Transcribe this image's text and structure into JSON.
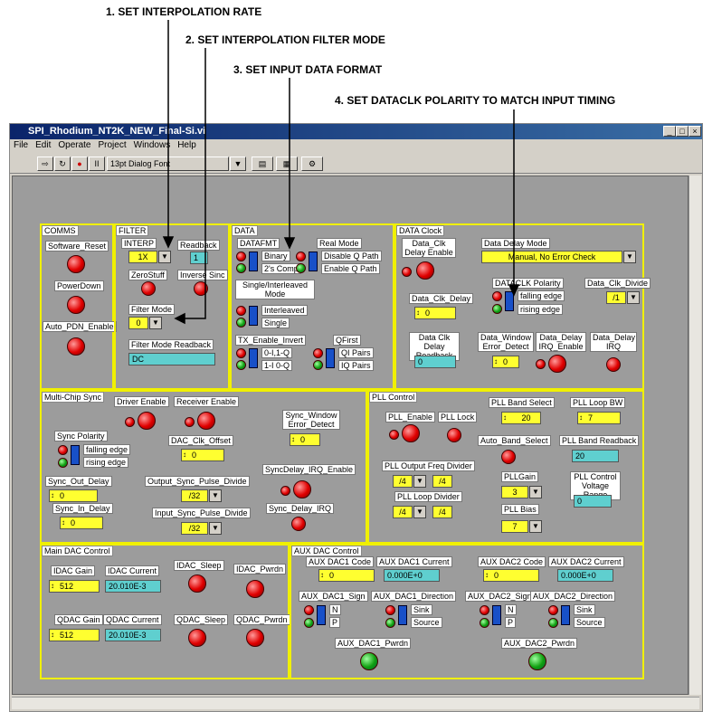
{
  "annotations": {
    "a1": "1. SET INTERPOLATION RATE",
    "a2": "2. SET INTERPOLATION FILTER MODE",
    "a3": "3. SET INPUT DATA FORMAT",
    "a4": "4. SET DATACLK POLARITY TO MATCH INPUT TIMING"
  },
  "window": {
    "title": "SPI_Rhodium_NT2K_NEW_Final-Si.vi",
    "min": "_",
    "max": "□",
    "close": "×"
  },
  "menu": [
    "File",
    "Edit",
    "Operate",
    "Project",
    "Windows",
    "Help"
  ],
  "toolbar": {
    "font": "13pt Dialog Font"
  },
  "comms": {
    "title": "COMMS",
    "software_reset": "Software_Reset",
    "powerdown": "PowerDown",
    "auto_pdn": "Auto_PDN_Enable"
  },
  "filter": {
    "title": "FILTER",
    "interp": "INTERP",
    "interp_val": "1X",
    "readback": "Readback",
    "readback_val": "1",
    "zerostuff": "ZeroStuff",
    "inverse_sinc": "Inverse Sinc",
    "filter_mode": "Filter Mode",
    "filter_mode_val": "0",
    "fm_readback": "Filter Mode Readback",
    "fm_readback_val": "DC"
  },
  "data": {
    "title": "DATA",
    "datafmt": "DATAFMT",
    "binary": "Binary",
    "twos": "2's Comp",
    "real_mode": "Real Mode",
    "disable_q": "Disable Q Path",
    "enable_q": "Enable Q Path",
    "single_inter": "Single/Interleaved Mode",
    "interleaved": "Interleaved",
    "single": "Single",
    "tx_enable": "TX_Enable_Invert",
    "tx0": "0-I,1-Q",
    "tx1": "1-I 0-Q",
    "qfirst": "QFirst",
    "qi": "QI Pairs",
    "iq": "IQ Pairs"
  },
  "dataclk": {
    "title": "DATA Clock",
    "delay_enable": "Data_Clk Delay Enable",
    "delay_mode": "Data Delay Mode",
    "delay_mode_val": "Manual, No Error Check",
    "clk_delay": "Data_Clk_Delay",
    "clk_delay_val": "0",
    "polarity": "DATACLK Polarity",
    "falling": "falling edge",
    "rising": "rising edge",
    "clk_divide": "Data_Clk_Divide",
    "clk_divide_val": "/1",
    "delay_rb": "Data Clk Delay Readback",
    "delay_rb_val": "0",
    "win_err": "Data_Window Error_Detect",
    "win_err_val": "0",
    "irq_en": "Data_Delay IRQ_Enable",
    "irq": "Data_Delay IRQ"
  },
  "mcs": {
    "title": "Multi-Chip Sync",
    "driver": "Driver Enable",
    "receiver": "Receiver Enable",
    "sync_win": "Sync_Window Error_Detect",
    "sync_win_val": "0",
    "sync_pol": "Sync Polarity",
    "falling": "falling edge",
    "rising": "rising edge",
    "dac_clk_off": "DAC_Clk_Offset",
    "dac_clk_off_val": "0",
    "sync_out": "Sync_Out_Delay",
    "sync_out_val": "0",
    "out_pulse": "Output_Sync_Pulse_Divide",
    "out_pulse_val": "/32",
    "irq_en": "SyncDelay_IRQ_Enable",
    "sync_in": "Sync_In_Delay",
    "sync_in_val": "0",
    "in_pulse": "Input_Sync_Pulse_Divide",
    "in_pulse_val": "/32",
    "sync_irq": "Sync_Delay_IRQ"
  },
  "pll": {
    "title": "PLL Control",
    "enable": "PLL_Enable",
    "lock": "PLL Lock",
    "band_sel": "PLL Band Select",
    "band_sel_val": "20",
    "loop_bw": "PLL Loop BW",
    "loop_bw_val": "7",
    "auto_band": "Auto_Band_Select",
    "band_rb": "PLL Band Readback",
    "band_rb_val": "20",
    "out_div": "PLL Output Freq Divider",
    "out_div_val": "/4",
    "out_div_rb": "/4",
    "gain": "PLLGain",
    "gain_val": "3",
    "vrange": "PLL Control Voltage Range",
    "vrange_val": "0",
    "loop_div": "PLL Loop Divider",
    "loop_div_val": "/4",
    "loop_div_rb": "/4",
    "bias": "PLL Bias",
    "bias_val": "7"
  },
  "main": {
    "title": "Main DAC Control",
    "idac_gain": "IDAC Gain",
    "idac_gain_val": "512",
    "idac_cur": "IDAC Current",
    "idac_cur_val": "20.010E-3",
    "idac_sleep": "IDAC_Sleep",
    "idac_pwrdn": "IDAC_Pwrdn",
    "qdac_gain": "QDAC Gain",
    "qdac_gain_val": "512",
    "qdac_cur": "QDAC Current",
    "qdac_cur_val": "20.010E-3",
    "qdac_sleep": "QDAC_Sleep",
    "qdac_pwrdn": "QDAC_Pwrdn"
  },
  "aux": {
    "title": "AUX DAC Control",
    "d1code": "AUX DAC1 Code",
    "d1code_val": "0",
    "d1cur": "AUX DAC1 Current",
    "d1cur_val": "0.000E+0",
    "d2code": "AUX DAC2 Code",
    "d2code_val": "0",
    "d2cur": "AUX DAC2 Current",
    "d2cur_val": "0.000E+0",
    "d1sign": "AUX_DAC1_Sign",
    "d1dir": "AUX_DAC1_Direction",
    "d2sign": "AUX_DAC2_Sign",
    "d2dir": "AUX_DAC2_Direction",
    "n": "N",
    "p": "P",
    "sink": "Sink",
    "source": "Source",
    "d1pwr": "AUX_DAC1_Pwrdn",
    "d2pwr": "AUX_DAC2_Pwrdn"
  }
}
